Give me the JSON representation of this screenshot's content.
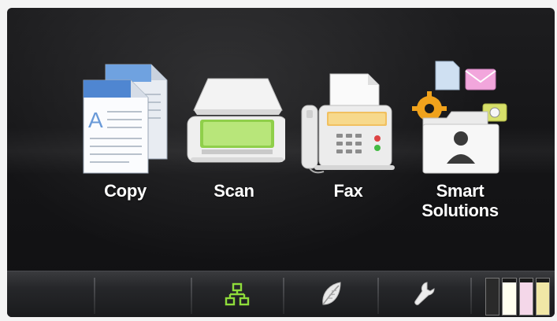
{
  "apps": [
    {
      "label": "Copy",
      "icon": "copy-icon"
    },
    {
      "label": "Scan",
      "icon": "scan-icon"
    },
    {
      "label": "Fax",
      "icon": "fax-icon"
    },
    {
      "label": "Smart\nSolutions",
      "icon": "smart-solutions-icon"
    }
  ],
  "bottom_bar": {
    "items": [
      "network-icon",
      "eco-mode-leaf-icon",
      "setup-wrench-icon",
      "ink-levels-icon"
    ],
    "ink_levels": [
      {
        "color": "#2a2a2a",
        "level": 1.0
      },
      {
        "color": "#fffff0",
        "level": 0.9
      },
      {
        "color": "#f4d7e9",
        "level": 0.9
      },
      {
        "color": "#f1e7a6",
        "level": 0.9
      }
    ]
  }
}
